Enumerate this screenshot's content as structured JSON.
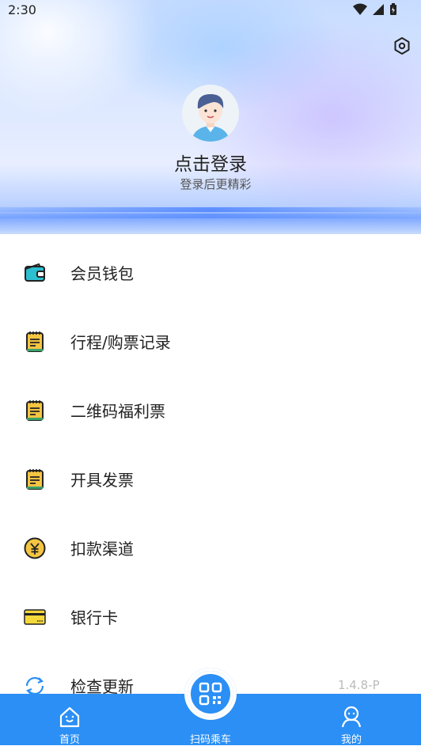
{
  "status_bar": {
    "time": "2:30"
  },
  "profile": {
    "login_title": "点击登录",
    "login_subtitle": "登录后更精彩"
  },
  "menu": {
    "items": [
      {
        "label": "会员钱包",
        "icon": "wallet-icon"
      },
      {
        "label": "行程/购票记录",
        "icon": "notepad-icon"
      },
      {
        "label": "二维码福利票",
        "icon": "notepad-icon"
      },
      {
        "label": "开具发票",
        "icon": "notepad-icon"
      },
      {
        "label": "扣款渠道",
        "icon": "yuan-coin-icon"
      },
      {
        "label": "银行卡",
        "icon": "bank-card-icon"
      },
      {
        "label": "检查更新",
        "icon": "refresh-icon"
      }
    ],
    "version": "1.4.8-P"
  },
  "tabbar": {
    "home": "首页",
    "scan": "扫码乘车",
    "mine": "我的"
  },
  "colors": {
    "primary": "#2b8ff5",
    "icon_yellow": "#f5c542",
    "icon_teal": "#2bbfd0"
  }
}
